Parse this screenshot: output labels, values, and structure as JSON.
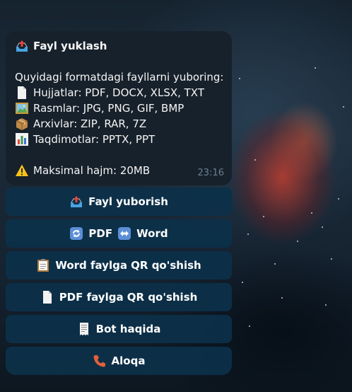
{
  "message": {
    "title": "Fayl yuklash",
    "title_icon": "outbox-tray-icon",
    "intro": "Quyidagi formatdagi fayllarni yuboring:",
    "formats": [
      {
        "icon": "document-icon",
        "text": "Hujjatlar: PDF, DOCX, XLSX, TXT"
      },
      {
        "icon": "picture-icon",
        "text": "Rasmlar: JPG, PNG, GIF, BMP"
      },
      {
        "icon": "package-icon",
        "text": "Arxivlar: ZIP, RAR, 7Z"
      },
      {
        "icon": "bar-chart-icon",
        "text": "Taqdimotlar: PPTX, PPT"
      }
    ],
    "warning_icon": "warning-icon",
    "warning": "Maksimal hajm: 20MB",
    "time": "23:16"
  },
  "keyboard": {
    "buttons": [
      {
        "icon": "outbox-tray-icon",
        "label": "Fayl yuborish"
      },
      {
        "icon": "arrows-cycle-icon",
        "label_a": "PDF",
        "icon_b": "left-right-arrow-icon",
        "label_b": "Word"
      },
      {
        "icon": "clipboard-icon",
        "label": "Word faylga QR qo'shish"
      },
      {
        "icon": "document-icon",
        "label": "PDF faylga QR qo'shish"
      },
      {
        "icon": "receipt-icon",
        "label": "Bot haqida"
      },
      {
        "icon": "telephone-icon",
        "label": "Aloqa"
      }
    ]
  },
  "colors": {
    "bubble": "#17212b",
    "keyboard_button": "#0c314a",
    "timestamp": "#6d7f8f",
    "text": "#f5f5f5"
  }
}
